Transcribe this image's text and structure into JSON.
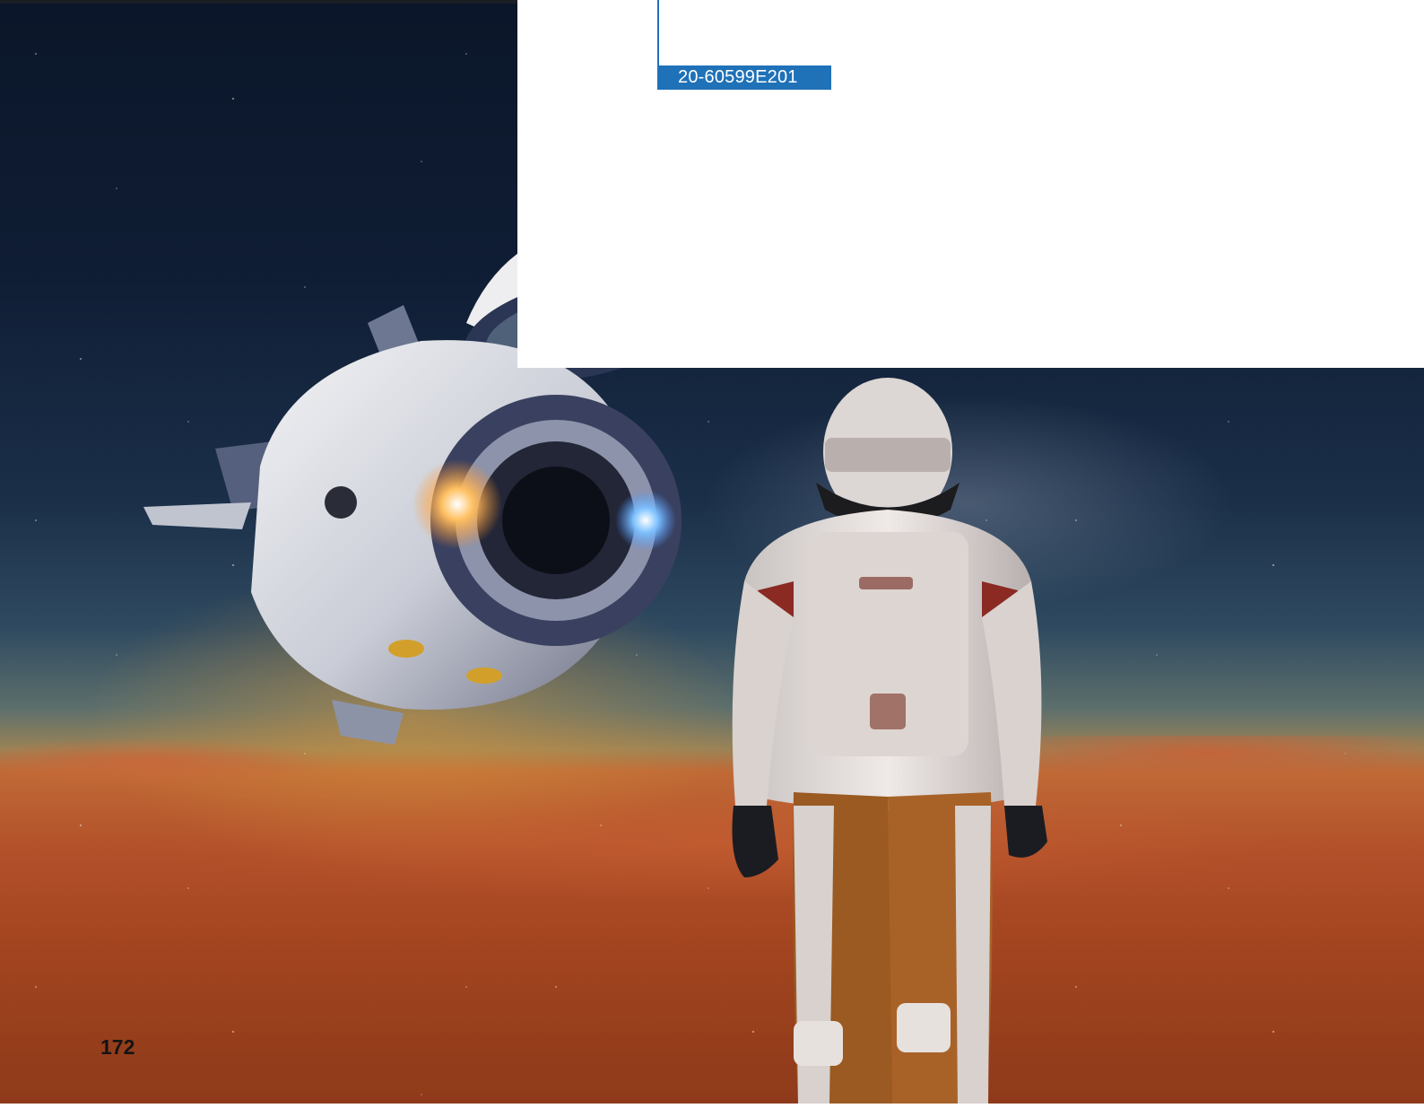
{
  "document": {
    "code": "20-60599E201",
    "page_number": "172"
  },
  "colors": {
    "accent": "#1f71b8",
    "page_number": "#141414"
  }
}
